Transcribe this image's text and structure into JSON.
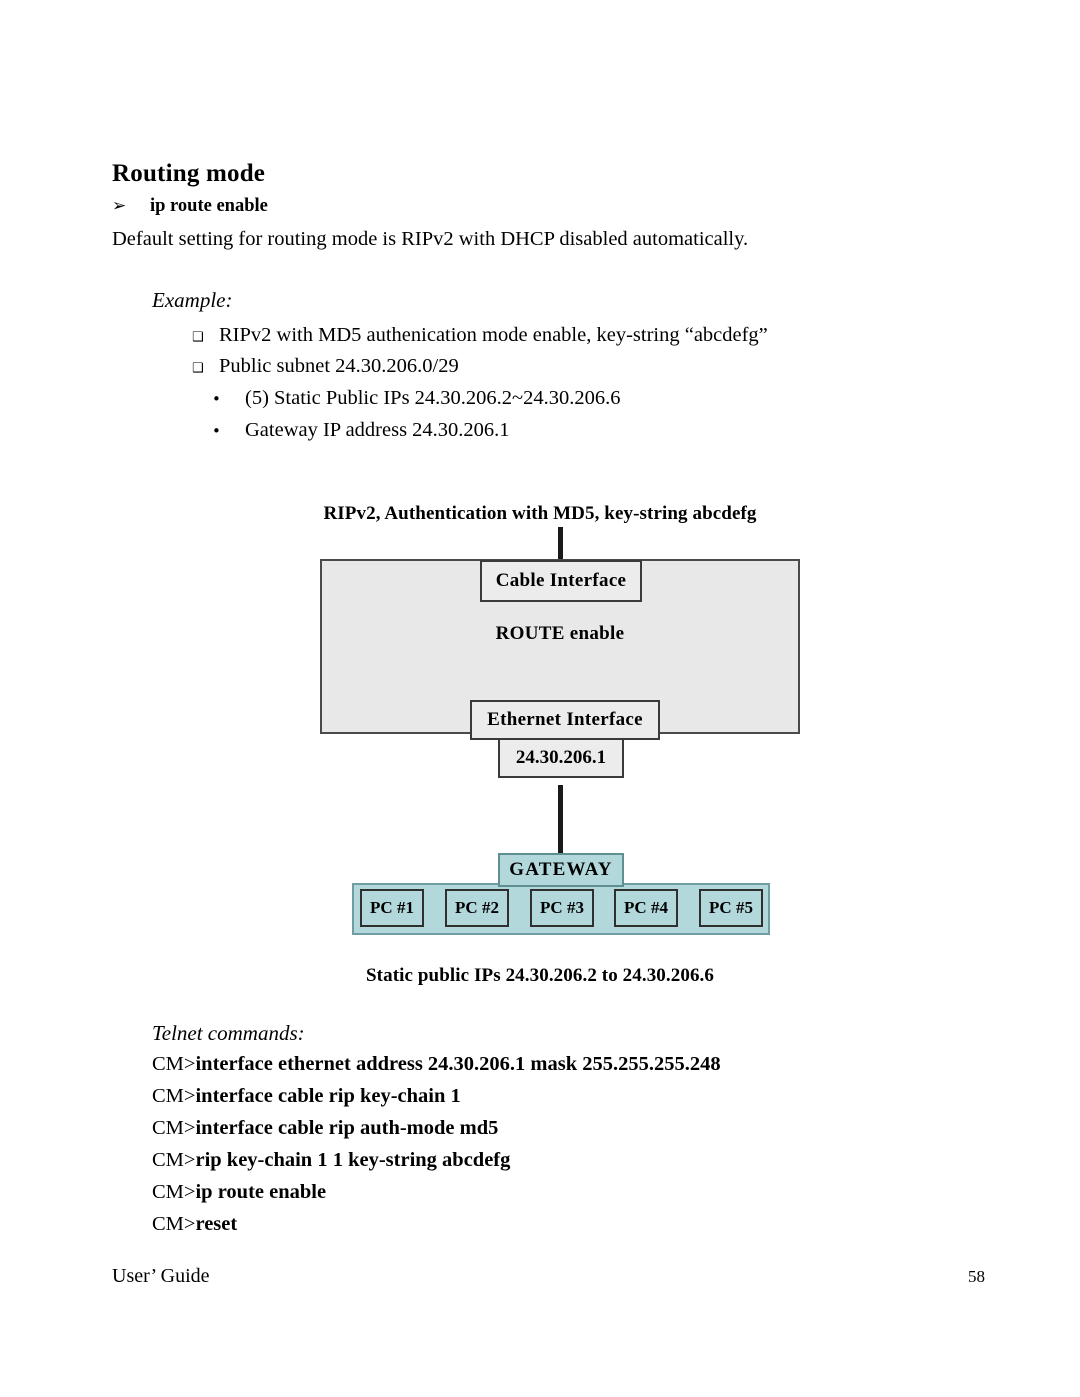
{
  "document": {
    "heading": "Routing mode",
    "arrow_bullet": {
      "glyph": "arrow-bullet-icon",
      "symbol": "➢",
      "label": "ip route enable"
    },
    "intro_paragraph": "Default setting for routing mode is RIPv2 with DHCP disabled automatically.",
    "example_label": "Example:",
    "square_bullet_symbol": "❑",
    "round_bullet_symbol": "•",
    "example_items": [
      "RIPv2 with MD5 authenication mode enable, key-string “abcdefg”",
      "Public subnet 24.30.206.0/29"
    ],
    "example_subitems": [
      "(5) Static Public IPs 24.30.206.2~24.30.206.6",
      "Gateway IP address 24.30.206.1"
    ]
  },
  "diagram": {
    "caption_top": "RIPv2, Authentication with MD5, key-string abcdefg",
    "caption_bottom": "Static public IPs 24.30.206.2 to 24.30.206.6",
    "router": {
      "cable_interface": "Cable Interface",
      "mode_label": "ROUTE enable",
      "ethernet_interface": "Ethernet Interface",
      "ethernet_ip": "24.30.206.1"
    },
    "gateway_label": "GATEWAY",
    "pcs": [
      "PC #1",
      "PC #2",
      "PC #3",
      "PC #4",
      "PC #5"
    ],
    "colors": {
      "router_fill": "#e8e8e8",
      "box_fill": "#ececec",
      "gateway_fill": "#b2d8db",
      "border": "#3a3a3a"
    }
  },
  "telnet": {
    "label": "Telnet commands:",
    "prompt": "CM>",
    "commands": [
      "interface ethernet address 24.30.206.1 mask 255.255.255.248",
      "interface cable rip key-chain 1",
      "interface cable rip auth-mode md5",
      "rip key-chain 1 1 key-string abcdefg",
      "ip route enable",
      "reset"
    ]
  },
  "footer": {
    "left": "User’ Guide",
    "page_number": "58"
  }
}
